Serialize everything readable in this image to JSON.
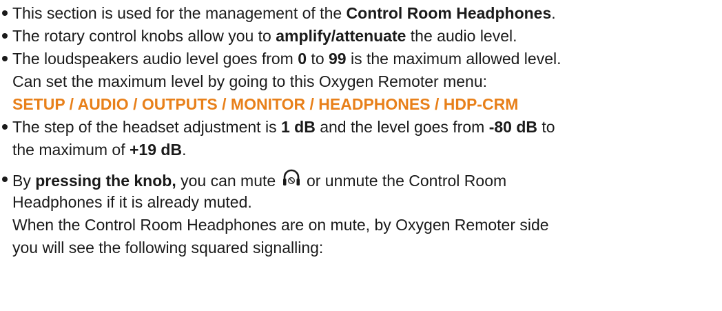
{
  "bullets": [
    {
      "lines": [
        [
          {
            "t": "This section is used for the management of the "
          },
          {
            "t": "Control Room Headphones",
            "b": true
          },
          {
            "t": "."
          }
        ]
      ]
    },
    {
      "lines": [
        [
          {
            "t": "The rotary control knobs allow you to "
          },
          {
            "t": "amplify/attenuate",
            "b": true
          },
          {
            "t": " the audio level."
          }
        ]
      ]
    },
    {
      "lines": [
        [
          {
            "t": "The loudspeakers audio level goes from "
          },
          {
            "t": "0",
            "b": true
          },
          {
            "t": " to "
          },
          {
            "t": "99",
            "b": true
          },
          {
            "t": " is the maximum allowed level."
          }
        ],
        [
          {
            "t": "Can set the maximum level by going to this Oxygen Remoter menu:"
          }
        ],
        [
          {
            "t": "SETUP / AUDIO / OUTPUTS / MONITOR / HEADPHONES / HDP-CRM",
            "menu": true
          }
        ]
      ]
    },
    {
      "lines": [
        [
          {
            "t": "The step of the headset adjustment is "
          },
          {
            "t": "1 dB",
            "b": true
          },
          {
            "t": " and the level goes from "
          },
          {
            "t": "-80 dB",
            "b": true
          },
          {
            "t": " to"
          }
        ],
        [
          {
            "t": "the maximum of "
          },
          {
            "t": "+19 dB",
            "b": true
          },
          {
            "t": "."
          }
        ]
      ]
    },
    {
      "gap": true,
      "lines": [
        [
          {
            "t": "By "
          },
          {
            "t": "pressing the knob,",
            "b": true
          },
          {
            "t": " you can mute "
          },
          {
            "icon": "headphones-mute-icon"
          },
          {
            "t": " or unmute the Control Room"
          }
        ],
        [
          {
            "t": "Headphones if it is already muted."
          }
        ],
        [
          {
            "t": "When the Control Room Headphones are on mute, by Oxygen Remoter side"
          }
        ],
        [
          {
            "t": "you will see the following squared signalling:"
          }
        ]
      ]
    }
  ],
  "colors": {
    "text": "#1a1a1a",
    "menu_path": "#e8801a"
  }
}
